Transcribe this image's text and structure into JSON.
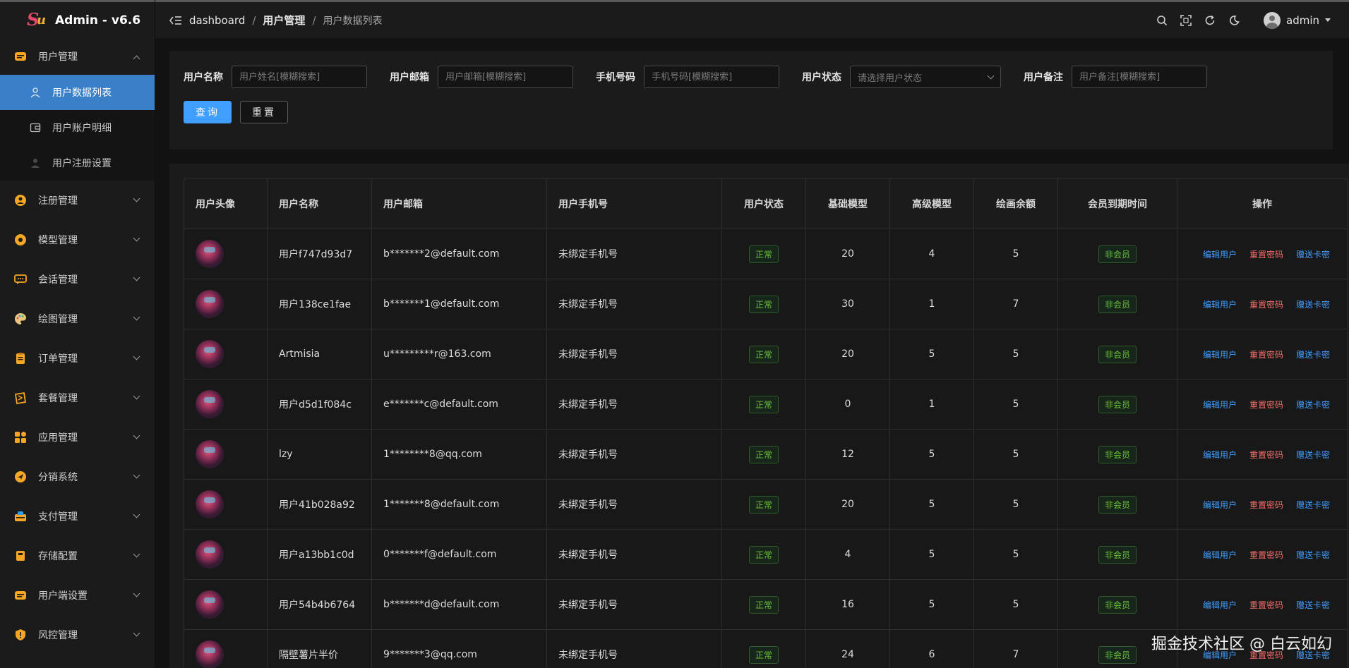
{
  "app": {
    "title": "Admin - v6.6"
  },
  "sidebar": {
    "items": [
      {
        "label": "用户管理",
        "icon": "user-card-icon",
        "open": true,
        "children": [
          {
            "label": "用户数据列表",
            "icon": "user-outline-icon",
            "active": true
          },
          {
            "label": "用户账户明细",
            "icon": "wallet-icon",
            "active": false
          },
          {
            "label": "用户注册设置",
            "icon": "user-add-icon",
            "active": false
          }
        ]
      },
      {
        "label": "注册管理",
        "icon": "register-icon"
      },
      {
        "label": "模型管理",
        "icon": "model-icon"
      },
      {
        "label": "会话管理",
        "icon": "chat-icon"
      },
      {
        "label": "绘图管理",
        "icon": "palette-icon"
      },
      {
        "label": "订单管理",
        "icon": "clipboard-icon"
      },
      {
        "label": "套餐管理",
        "icon": "package-icon"
      },
      {
        "label": "应用管理",
        "icon": "apps-icon"
      },
      {
        "label": "分销系统",
        "icon": "share-icon"
      },
      {
        "label": "支付管理",
        "icon": "payment-icon"
      },
      {
        "label": "存储配置",
        "icon": "storage-icon"
      },
      {
        "label": "用户端设置",
        "icon": "client-settings-icon"
      },
      {
        "label": "风控管理",
        "icon": "shield-icon"
      }
    ]
  },
  "header": {
    "breadcrumb": [
      "dashboard",
      "用户管理",
      "用户数据列表"
    ],
    "user": "admin"
  },
  "search": {
    "fields": [
      {
        "label": "用户名称",
        "placeholder": "用户姓名[模糊搜索]"
      },
      {
        "label": "用户邮箱",
        "placeholder": "用户邮箱[模糊搜索]"
      },
      {
        "label": "手机号码",
        "placeholder": "手机号码[模糊搜索]"
      },
      {
        "label": "用户状态",
        "placeholder": "请选择用户状态"
      },
      {
        "label": "用户备注",
        "placeholder": "用户备注[模糊搜索]"
      }
    ],
    "query_label": "查询",
    "reset_label": "重置"
  },
  "table": {
    "columns": [
      "用户头像",
      "用户名称",
      "用户邮箱",
      "用户手机号",
      "用户状态",
      "基础模型",
      "高级模型",
      "绘画余额",
      "会员到期时间",
      "操作"
    ],
    "actions": {
      "edit": "编辑用户",
      "reset": "重置密码",
      "gift": "赠送卡密"
    },
    "rows": [
      {
        "name": "用户f747d93d7",
        "email": "b*******2@default.com",
        "phone": "未绑定手机号",
        "status": "正常",
        "basic": "20",
        "advanced": "4",
        "draw": "5",
        "vip": "非会员"
      },
      {
        "name": "用户138ce1fae",
        "email": "b*******1@default.com",
        "phone": "未绑定手机号",
        "status": "正常",
        "basic": "30",
        "advanced": "1",
        "draw": "7",
        "vip": "非会员"
      },
      {
        "name": "Artmisia",
        "email": "u*********r@163.com",
        "phone": "未绑定手机号",
        "status": "正常",
        "basic": "20",
        "advanced": "5",
        "draw": "5",
        "vip": "非会员"
      },
      {
        "name": "用户d5d1f084c",
        "email": "e*******c@default.com",
        "phone": "未绑定手机号",
        "status": "正常",
        "basic": "0",
        "advanced": "1",
        "draw": "5",
        "vip": "非会员"
      },
      {
        "name": "lzy",
        "email": "1********8@qq.com",
        "phone": "未绑定手机号",
        "status": "正常",
        "basic": "12",
        "advanced": "5",
        "draw": "5",
        "vip": "非会员"
      },
      {
        "name": "用户41b028a92",
        "email": "1*******8@default.com",
        "phone": "未绑定手机号",
        "status": "正常",
        "basic": "20",
        "advanced": "5",
        "draw": "5",
        "vip": "非会员"
      },
      {
        "name": "用户a13bb1c0d",
        "email": "0*******f@default.com",
        "phone": "未绑定手机号",
        "status": "正常",
        "basic": "4",
        "advanced": "5",
        "draw": "5",
        "vip": "非会员"
      },
      {
        "name": "用户54b4b6764",
        "email": "b*******d@default.com",
        "phone": "未绑定手机号",
        "status": "正常",
        "basic": "16",
        "advanced": "5",
        "draw": "5",
        "vip": "非会员"
      },
      {
        "name": "隔壁薯片半价",
        "email": "9*******3@qq.com",
        "phone": "未绑定手机号",
        "status": "正常",
        "basic": "24",
        "advanced": "6",
        "draw": "7",
        "vip": "非会员"
      }
    ]
  },
  "watermark": "掘金技术社区 @ 白云如幻"
}
